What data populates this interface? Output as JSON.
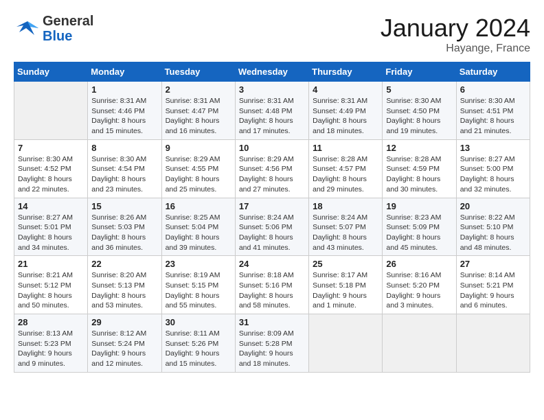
{
  "header": {
    "logo_general": "General",
    "logo_blue": "Blue",
    "month_title": "January 2024",
    "location": "Hayange, France"
  },
  "days_of_week": [
    "Sunday",
    "Monday",
    "Tuesday",
    "Wednesday",
    "Thursday",
    "Friday",
    "Saturday"
  ],
  "weeks": [
    [
      {
        "day": "",
        "sunrise": "",
        "sunset": "",
        "daylight": ""
      },
      {
        "day": "1",
        "sunrise": "Sunrise: 8:31 AM",
        "sunset": "Sunset: 4:46 PM",
        "daylight": "Daylight: 8 hours and 15 minutes."
      },
      {
        "day": "2",
        "sunrise": "Sunrise: 8:31 AM",
        "sunset": "Sunset: 4:47 PM",
        "daylight": "Daylight: 8 hours and 16 minutes."
      },
      {
        "day": "3",
        "sunrise": "Sunrise: 8:31 AM",
        "sunset": "Sunset: 4:48 PM",
        "daylight": "Daylight: 8 hours and 17 minutes."
      },
      {
        "day": "4",
        "sunrise": "Sunrise: 8:31 AM",
        "sunset": "Sunset: 4:49 PM",
        "daylight": "Daylight: 8 hours and 18 minutes."
      },
      {
        "day": "5",
        "sunrise": "Sunrise: 8:30 AM",
        "sunset": "Sunset: 4:50 PM",
        "daylight": "Daylight: 8 hours and 19 minutes."
      },
      {
        "day": "6",
        "sunrise": "Sunrise: 8:30 AM",
        "sunset": "Sunset: 4:51 PM",
        "daylight": "Daylight: 8 hours and 21 minutes."
      }
    ],
    [
      {
        "day": "7",
        "sunrise": "Sunrise: 8:30 AM",
        "sunset": "Sunset: 4:52 PM",
        "daylight": "Daylight: 8 hours and 22 minutes."
      },
      {
        "day": "8",
        "sunrise": "Sunrise: 8:30 AM",
        "sunset": "Sunset: 4:54 PM",
        "daylight": "Daylight: 8 hours and 23 minutes."
      },
      {
        "day": "9",
        "sunrise": "Sunrise: 8:29 AM",
        "sunset": "Sunset: 4:55 PM",
        "daylight": "Daylight: 8 hours and 25 minutes."
      },
      {
        "day": "10",
        "sunrise": "Sunrise: 8:29 AM",
        "sunset": "Sunset: 4:56 PM",
        "daylight": "Daylight: 8 hours and 27 minutes."
      },
      {
        "day": "11",
        "sunrise": "Sunrise: 8:28 AM",
        "sunset": "Sunset: 4:57 PM",
        "daylight": "Daylight: 8 hours and 29 minutes."
      },
      {
        "day": "12",
        "sunrise": "Sunrise: 8:28 AM",
        "sunset": "Sunset: 4:59 PM",
        "daylight": "Daylight: 8 hours and 30 minutes."
      },
      {
        "day": "13",
        "sunrise": "Sunrise: 8:27 AM",
        "sunset": "Sunset: 5:00 PM",
        "daylight": "Daylight: 8 hours and 32 minutes."
      }
    ],
    [
      {
        "day": "14",
        "sunrise": "Sunrise: 8:27 AM",
        "sunset": "Sunset: 5:01 PM",
        "daylight": "Daylight: 8 hours and 34 minutes."
      },
      {
        "day": "15",
        "sunrise": "Sunrise: 8:26 AM",
        "sunset": "Sunset: 5:03 PM",
        "daylight": "Daylight: 8 hours and 36 minutes."
      },
      {
        "day": "16",
        "sunrise": "Sunrise: 8:25 AM",
        "sunset": "Sunset: 5:04 PM",
        "daylight": "Daylight: 8 hours and 39 minutes."
      },
      {
        "day": "17",
        "sunrise": "Sunrise: 8:24 AM",
        "sunset": "Sunset: 5:06 PM",
        "daylight": "Daylight: 8 hours and 41 minutes."
      },
      {
        "day": "18",
        "sunrise": "Sunrise: 8:24 AM",
        "sunset": "Sunset: 5:07 PM",
        "daylight": "Daylight: 8 hours and 43 minutes."
      },
      {
        "day": "19",
        "sunrise": "Sunrise: 8:23 AM",
        "sunset": "Sunset: 5:09 PM",
        "daylight": "Daylight: 8 hours and 45 minutes."
      },
      {
        "day": "20",
        "sunrise": "Sunrise: 8:22 AM",
        "sunset": "Sunset: 5:10 PM",
        "daylight": "Daylight: 8 hours and 48 minutes."
      }
    ],
    [
      {
        "day": "21",
        "sunrise": "Sunrise: 8:21 AM",
        "sunset": "Sunset: 5:12 PM",
        "daylight": "Daylight: 8 hours and 50 minutes."
      },
      {
        "day": "22",
        "sunrise": "Sunrise: 8:20 AM",
        "sunset": "Sunset: 5:13 PM",
        "daylight": "Daylight: 8 hours and 53 minutes."
      },
      {
        "day": "23",
        "sunrise": "Sunrise: 8:19 AM",
        "sunset": "Sunset: 5:15 PM",
        "daylight": "Daylight: 8 hours and 55 minutes."
      },
      {
        "day": "24",
        "sunrise": "Sunrise: 8:18 AM",
        "sunset": "Sunset: 5:16 PM",
        "daylight": "Daylight: 8 hours and 58 minutes."
      },
      {
        "day": "25",
        "sunrise": "Sunrise: 8:17 AM",
        "sunset": "Sunset: 5:18 PM",
        "daylight": "Daylight: 9 hours and 1 minute."
      },
      {
        "day": "26",
        "sunrise": "Sunrise: 8:16 AM",
        "sunset": "Sunset: 5:20 PM",
        "daylight": "Daylight: 9 hours and 3 minutes."
      },
      {
        "day": "27",
        "sunrise": "Sunrise: 8:14 AM",
        "sunset": "Sunset: 5:21 PM",
        "daylight": "Daylight: 9 hours and 6 minutes."
      }
    ],
    [
      {
        "day": "28",
        "sunrise": "Sunrise: 8:13 AM",
        "sunset": "Sunset: 5:23 PM",
        "daylight": "Daylight: 9 hours and 9 minutes."
      },
      {
        "day": "29",
        "sunrise": "Sunrise: 8:12 AM",
        "sunset": "Sunset: 5:24 PM",
        "daylight": "Daylight: 9 hours and 12 minutes."
      },
      {
        "day": "30",
        "sunrise": "Sunrise: 8:11 AM",
        "sunset": "Sunset: 5:26 PM",
        "daylight": "Daylight: 9 hours and 15 minutes."
      },
      {
        "day": "31",
        "sunrise": "Sunrise: 8:09 AM",
        "sunset": "Sunset: 5:28 PM",
        "daylight": "Daylight: 9 hours and 18 minutes."
      },
      {
        "day": "",
        "sunrise": "",
        "sunset": "",
        "daylight": ""
      },
      {
        "day": "",
        "sunrise": "",
        "sunset": "",
        "daylight": ""
      },
      {
        "day": "",
        "sunrise": "",
        "sunset": "",
        "daylight": ""
      }
    ]
  ]
}
